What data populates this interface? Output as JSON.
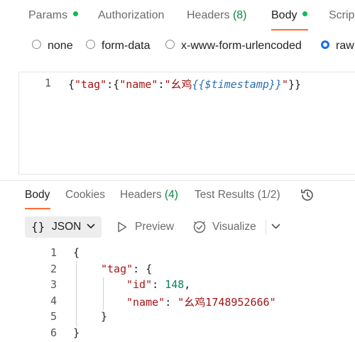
{
  "request_tabs": {
    "params": "Params",
    "authorization": "Authorization",
    "headers": "Headers",
    "headers_count": "(8)",
    "body": "Body",
    "scripts": "Scrip"
  },
  "body_types": {
    "none": "none",
    "form_data": "form-data",
    "urlencoded": "x-www-form-urlencoded",
    "raw": "raw",
    "selected": "raw"
  },
  "request_editor": {
    "line_number": "1",
    "code_open": "{",
    "key_tag": "\"tag\"",
    "colon1": ":",
    "brace_inner": "{",
    "key_name": "\"name\"",
    "colon2": ":",
    "value_prefix": "\"幺鸡",
    "variable": "{{$timestamp}}",
    "value_suffix": "\"",
    "code_close": "}}"
  },
  "response_tabs": {
    "body": "Body",
    "cookies": "Cookies",
    "headers": "Headers",
    "headers_count": "(4)",
    "test_results": "Test Results",
    "test_count": "(1/2)"
  },
  "toolbar": {
    "format_braces": "{}",
    "format": "JSON",
    "preview": "Preview",
    "visualize": "Visualize"
  },
  "response_body": {
    "line_numbers": [
      "1",
      "2",
      "3",
      "4",
      "5",
      "6"
    ],
    "l1": "{",
    "l2_key": "\"tag\"",
    "l2_rest": ": {",
    "l3_key": "\"id\"",
    "l3_sep": ": ",
    "l3_val": "148",
    "l3_comma": ",",
    "l4_key": "\"name\"",
    "l4_sep": ": ",
    "l4_val": "\"幺鸡1748952666\"",
    "l5": "}",
    "l6": "}"
  },
  "colors": {
    "accent": "#ff6c37",
    "status_dot": "#0cbb52",
    "radio_selected": "#1a6de0",
    "json_key": "#a31515",
    "json_number": "#098658",
    "variable": "#2a6fb0"
  }
}
